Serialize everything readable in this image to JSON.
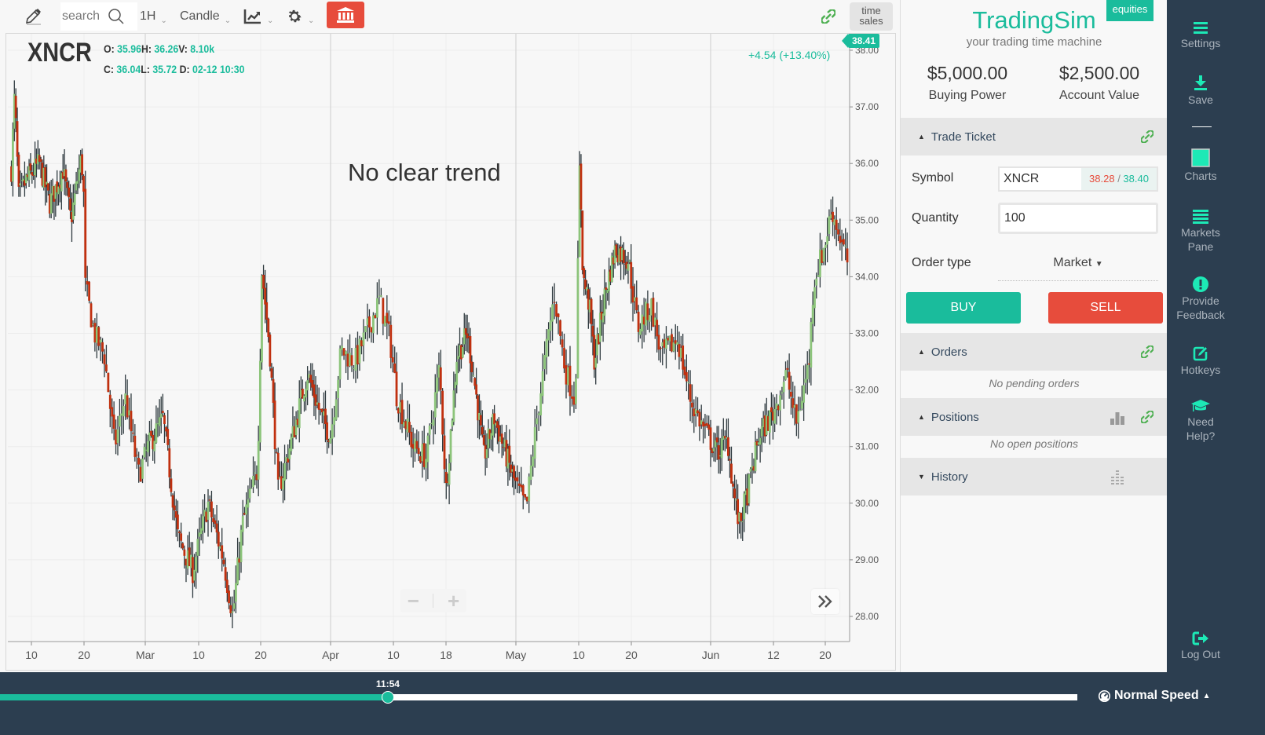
{
  "toolbar": {
    "search_placeholder": "search",
    "interval": "1H",
    "chart_type": "Candle",
    "time_sales_line1": "time",
    "time_sales_line2": "sales"
  },
  "chart_header": {
    "symbol": "XNCR",
    "open_label": "O:",
    "open": "35.96",
    "high_label": "H:",
    "high": "36.26",
    "volume_label": "V:",
    "volume": "8.10k",
    "close_label": "C:",
    "close": "36.04",
    "low_label": "L:",
    "low": "35.72",
    "date_label": "D:",
    "date": "02-12 10:30",
    "change": "+4.54 (+13.40%)",
    "last_price": "38.41",
    "annotation": "No clear trend"
  },
  "colors": {
    "accent": "#1abc9c",
    "up_candle": "#8cc47a",
    "down_candle": "#c0300f",
    "wick": "#2f3a3f",
    "sell": "#e74c3c",
    "nav_bg": "#2c3e50",
    "link_icon": "#4caf50"
  },
  "chart_data": {
    "type": "candlestick",
    "symbol": "XNCR",
    "interval": "1H",
    "ylabel": "",
    "xlabel": "",
    "ylim": [
      27.7,
      38.3
    ],
    "y_ticks": [
      "28.00",
      "29.00",
      "30.00",
      "31.00",
      "32.00",
      "33.00",
      "34.00",
      "35.00",
      "36.00",
      "37.00",
      "38.00"
    ],
    "x_ticks": [
      {
        "label": "10",
        "day": 10
      },
      {
        "label": "20",
        "day": 20
      },
      {
        "label": "Mar",
        "day": 29
      },
      {
        "label": "10",
        "day": 38
      },
      {
        "label": "20",
        "day": 48
      },
      {
        "label": "Apr",
        "day": 60
      },
      {
        "label": "10",
        "day": 69
      },
      {
        "label": "18",
        "day": 77
      },
      {
        "label": "May",
        "day": 90
      },
      {
        "label": "10",
        "day": 99
      },
      {
        "label": "20",
        "day": 109
      },
      {
        "label": "Jun",
        "day": 121
      },
      {
        "label": "12",
        "day": 132
      },
      {
        "label": "20",
        "day": 140
      }
    ],
    "x_range_days": [
      6,
      144
    ],
    "price_path": [
      {
        "day": 6.2,
        "price": 35.9
      },
      {
        "day": 6.8,
        "price": 37.2
      },
      {
        "day": 7.6,
        "price": 35.4
      },
      {
        "day": 9.0,
        "price": 35.7
      },
      {
        "day": 11.5,
        "price": 36.0
      },
      {
        "day": 13.5,
        "price": 35.3
      },
      {
        "day": 16.0,
        "price": 35.9
      },
      {
        "day": 17.5,
        "price": 35.0
      },
      {
        "day": 19.5,
        "price": 36.1
      },
      {
        "day": 19.9,
        "price": 35.6
      },
      {
        "day": 20.1,
        "price": 33.9
      },
      {
        "day": 21.5,
        "price": 33.0
      },
      {
        "day": 23.0,
        "price": 32.6
      },
      {
        "day": 24.5,
        "price": 31.0
      },
      {
        "day": 26.0,
        "price": 31.9
      },
      {
        "day": 28.0,
        "price": 30.5
      },
      {
        "day": 29.5,
        "price": 31.0
      },
      {
        "day": 32.0,
        "price": 31.5
      },
      {
        "day": 34.5,
        "price": 29.4
      },
      {
        "day": 37.0,
        "price": 28.8
      },
      {
        "day": 39.5,
        "price": 30.0
      },
      {
        "day": 42.0,
        "price": 29.0
      },
      {
        "day": 43.5,
        "price": 28.0
      },
      {
        "day": 45.0,
        "price": 29.6
      },
      {
        "day": 47.5,
        "price": 30.6
      },
      {
        "day": 48.2,
        "price": 34.1
      },
      {
        "day": 49.5,
        "price": 32.8
      },
      {
        "day": 51.0,
        "price": 30.2
      },
      {
        "day": 53.5,
        "price": 31.2
      },
      {
        "day": 56.0,
        "price": 32.3
      },
      {
        "day": 58.5,
        "price": 31.5
      },
      {
        "day": 60.0,
        "price": 31.2
      },
      {
        "day": 61.5,
        "price": 32.7
      },
      {
        "day": 63.5,
        "price": 32.5
      },
      {
        "day": 67.0,
        "price": 33.6
      },
      {
        "day": 68.5,
        "price": 32.9
      },
      {
        "day": 69.5,
        "price": 31.9
      },
      {
        "day": 72.0,
        "price": 31.0
      },
      {
        "day": 74.0,
        "price": 30.8
      },
      {
        "day": 76.0,
        "price": 32.4
      },
      {
        "day": 77.0,
        "price": 30.2
      },
      {
        "day": 79.0,
        "price": 32.6
      },
      {
        "day": 81.0,
        "price": 33.0
      },
      {
        "day": 82.5,
        "price": 32.0
      },
      {
        "day": 84.0,
        "price": 30.8
      },
      {
        "day": 86.0,
        "price": 31.5
      },
      {
        "day": 88.0,
        "price": 30.9
      },
      {
        "day": 90.0,
        "price": 30.3
      },
      {
        "day": 91.5,
        "price": 29.9
      },
      {
        "day": 93.0,
        "price": 31.5
      },
      {
        "day": 95.5,
        "price": 33.7
      },
      {
        "day": 97.0,
        "price": 32.4
      },
      {
        "day": 98.5,
        "price": 31.8
      },
      {
        "day": 99.2,
        "price": 36.1
      },
      {
        "day": 99.8,
        "price": 34.0
      },
      {
        "day": 101.0,
        "price": 33.5
      },
      {
        "day": 102.0,
        "price": 32.5
      },
      {
        "day": 104.0,
        "price": 33.7
      },
      {
        "day": 106.0,
        "price": 34.5
      },
      {
        "day": 108.5,
        "price": 34.3
      },
      {
        "day": 110.0,
        "price": 33.1
      },
      {
        "day": 112.0,
        "price": 33.5
      },
      {
        "day": 113.5,
        "price": 32.6
      },
      {
        "day": 116.0,
        "price": 32.9
      },
      {
        "day": 118.0,
        "price": 31.8
      },
      {
        "day": 120.0,
        "price": 31.3
      },
      {
        "day": 122.0,
        "price": 30.9
      },
      {
        "day": 124.0,
        "price": 31.1
      },
      {
        "day": 125.0,
        "price": 30.2
      },
      {
        "day": 126.0,
        "price": 29.6
      },
      {
        "day": 127.5,
        "price": 30.2
      },
      {
        "day": 129.5,
        "price": 31.2
      },
      {
        "day": 132.0,
        "price": 31.6
      },
      {
        "day": 134.0,
        "price": 32.3
      },
      {
        "day": 135.5,
        "price": 31.4
      },
      {
        "day": 137.5,
        "price": 32.5
      },
      {
        "day": 138.2,
        "price": 33.9
      },
      {
        "day": 140.0,
        "price": 34.6
      },
      {
        "day": 141.0,
        "price": 35.2
      },
      {
        "day": 142.5,
        "price": 34.6
      },
      {
        "day": 143.6,
        "price": 34.2
      }
    ]
  },
  "right_panel": {
    "brand": "TradingSim",
    "tagline": "your trading time machine",
    "badge": "equities",
    "buying_power_value": "$5,000.00",
    "buying_power_label": "Buying Power",
    "account_value_value": "$2,500.00",
    "account_value_label": "Account Value",
    "trade_ticket": {
      "title": "Trade Ticket",
      "symbol_label": "Symbol",
      "symbol_value": "XNCR",
      "bid": "38.28",
      "quote_sep": " / ",
      "ask": "38.40",
      "quantity_label": "Quantity",
      "quantity_value": "100",
      "order_type_label": "Order type",
      "order_type_value": "Market",
      "buy_label": "BUY",
      "sell_label": "SELL"
    },
    "orders": {
      "title": "Orders",
      "empty": "No pending orders"
    },
    "positions": {
      "title": "Positions",
      "empty": "No open positions"
    },
    "history": {
      "title": "History"
    }
  },
  "nav": {
    "settings": "Settings",
    "save": "Save",
    "charts": "Charts",
    "markets_pane_1": "Markets",
    "markets_pane_2": "Pane",
    "feedback_1": "Provide",
    "feedback_2": "Feedback",
    "hotkeys": "Hotkeys",
    "help_1": "Need",
    "help_2": "Help?",
    "logout": "Log Out"
  },
  "playback": {
    "time": "11:54",
    "progress": 0.36,
    "speed": "Normal Speed"
  }
}
